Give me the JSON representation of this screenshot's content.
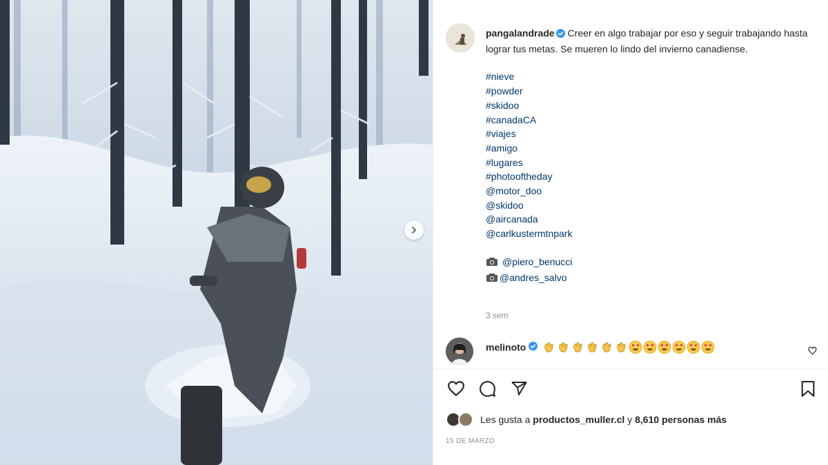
{
  "post": {
    "username": "pangalandrade",
    "caption_text": "Creer en algo trabajar por eso y seguir trabajando hasta lograr tus metas. Se mueren lo lindo del invierno canadiense.",
    "hashtags": [
      "#nieve",
      "#powder",
      "#skidoo",
      "#canadaCA",
      "#viajes",
      "#amigo",
      "#lugares",
      "#photooftheday",
      "@motor_doo",
      "@skidoo",
      "@aircanada",
      "@carlkustermtnpark"
    ],
    "credits": [
      "@piero_benucci",
      "@andres_salvo"
    ],
    "time_ago": "3 sem",
    "date": "15 DE MARZO"
  },
  "comment": {
    "username": "melinoto",
    "emojis": [
      "clap",
      "clap",
      "clap",
      "clap",
      "clap",
      "clap",
      "heart-eyes",
      "heart-eyes",
      "heart-eyes",
      "heart-eyes",
      "heart-eyes",
      "heart-eyes"
    ]
  },
  "likes": {
    "prefix": "Les gusta a",
    "first_user": "productos_muller.cl",
    "connector": "y",
    "others": "8,610 personas más"
  },
  "icons": {
    "verified": "verified-badge-icon",
    "like": "heart-outline-icon",
    "comment": "comment-bubble-icon",
    "share": "paper-plane-icon",
    "save": "bookmark-icon",
    "next": "chevron-right-icon",
    "camera": "camera-icon"
  },
  "colors": {
    "link": "#00376b",
    "verified": "#3897f0",
    "meta": "#8e8e8e",
    "text": "#262626"
  }
}
